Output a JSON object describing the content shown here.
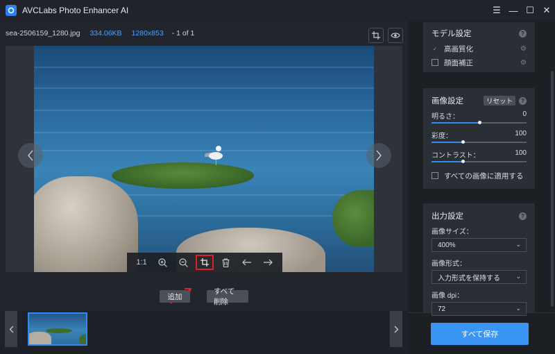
{
  "app": {
    "title": "AVCLabs Photo Enhancer AI"
  },
  "window_controls": {
    "menu": "☰",
    "minimize": "—",
    "maximize": "☐",
    "close": "✕"
  },
  "file_info": {
    "name": "sea-2506159_1280.jpg",
    "size": "334.06KB",
    "resolution": "1280x853",
    "count": "- 1 of 1"
  },
  "image_toolbar": {
    "ratio_label": "1:1",
    "items": [
      "zoom-in-icon",
      "zoom-out-icon",
      "crop-icon",
      "trash-icon",
      "arrow-left-icon",
      "arrow-right-icon"
    ],
    "active_item": "crop-icon"
  },
  "actions": {
    "add_label": "追加",
    "delete_all_label": "すべて削除"
  },
  "model_settings": {
    "title": "モデル設定",
    "options": [
      {
        "label": "高画質化",
        "checked": true
      },
      {
        "label": "顔面補正",
        "checked": false
      }
    ]
  },
  "image_settings": {
    "title": "画像設定",
    "reset_label": "リセット",
    "sliders": [
      {
        "label": "明るさ：",
        "value": "0",
        "fraction": 0.5
      },
      {
        "label": "彩度：",
        "value": "100",
        "fraction": 0.33
      },
      {
        "label": "コントラスト：",
        "value": "100",
        "fraction": 0.33
      }
    ],
    "apply_all_label": "すべての画像に適用する"
  },
  "output_settings": {
    "title": "出力設定",
    "image_size_label": "画像サイズ：",
    "image_size_value": "400%",
    "image_format_label": "画像形式：",
    "image_format_value": "入力形式を保持する",
    "image_dpi_label": "画像 dpi：",
    "image_dpi_value": "72"
  },
  "save_all_label": "すべて保存",
  "colors": {
    "accent": "#3b95f5",
    "link": "#4aa3ff",
    "highlight": "#e0202a"
  }
}
